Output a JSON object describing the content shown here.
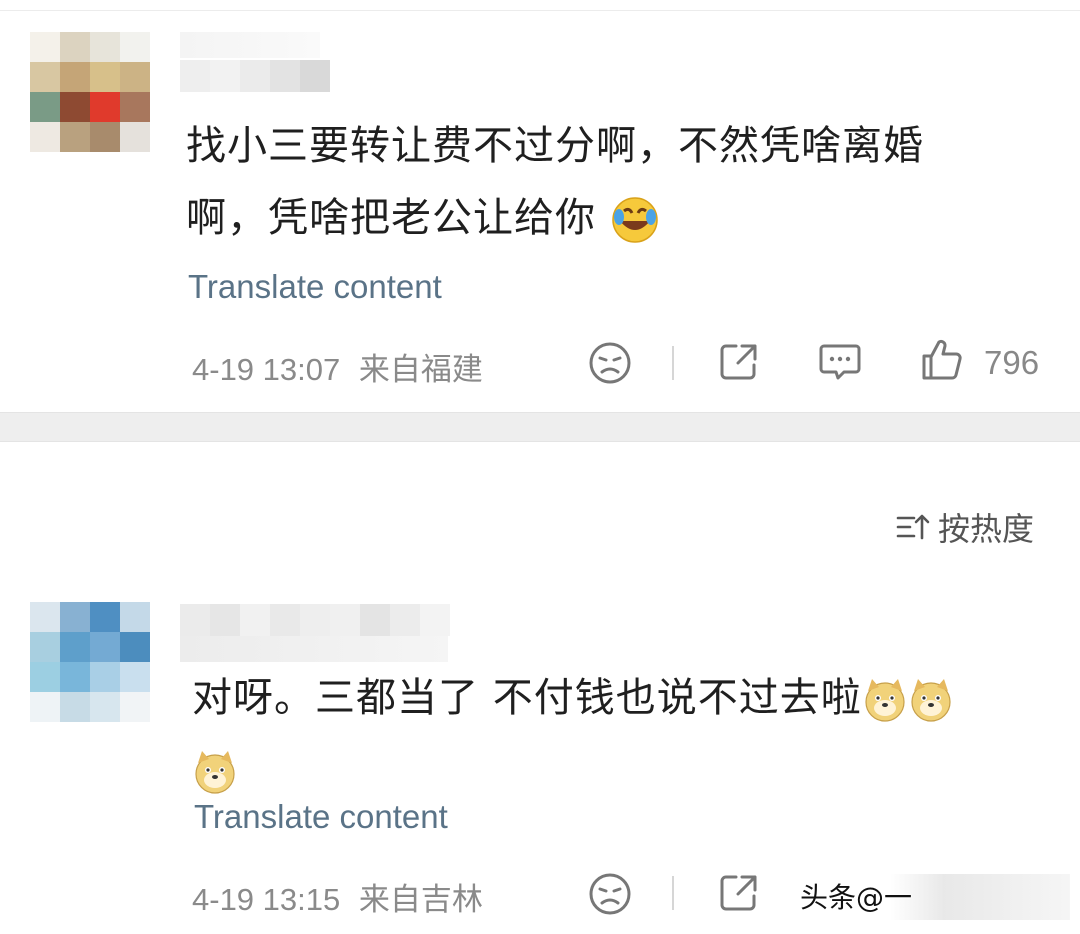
{
  "comments": [
    {
      "text_line1": "找小三要转让费不过分啊，不然凭啥离婚",
      "text_line2": "啊，凭啥把老公让给你",
      "emoji_name": "laugh-cry",
      "translate_label": "Translate content",
      "timestamp": "4-19 13:07",
      "location": "来自福建",
      "like_count": "796"
    },
    {
      "text_line1": "对呀。三都当了 不付钱也说不过去啦",
      "emoji_name": "doge",
      "translate_label": "Translate content",
      "timestamp": "4-19 13:15",
      "location": "来自吉林"
    }
  ],
  "sort": {
    "label": "按热度",
    "icon": "sort-icon"
  },
  "watermark": {
    "text": "头条@一"
  },
  "colors": {
    "translate": "#5a7387",
    "meta": "#8a8a8a",
    "divider": "#eeeeee"
  }
}
